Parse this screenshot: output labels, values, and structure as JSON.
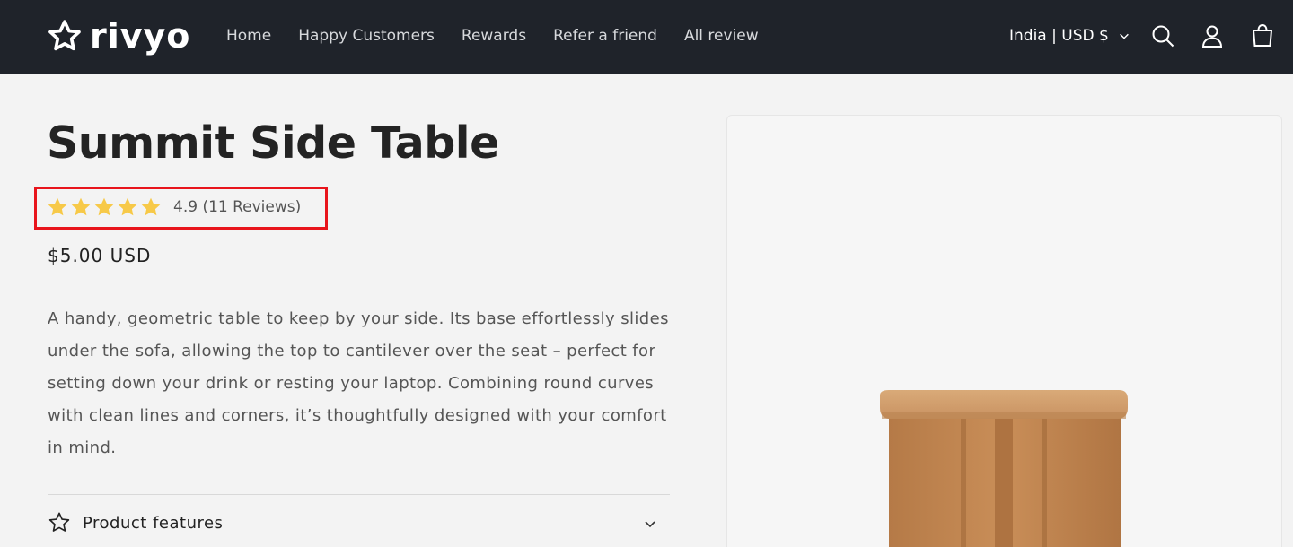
{
  "header": {
    "logo_text": "rivyo",
    "nav": [
      "Home",
      "Happy Customers",
      "Rewards",
      "Refer a friend",
      "All review"
    ],
    "currency": "India | USD $",
    "icons": [
      "search-icon",
      "account-icon",
      "cart-icon"
    ]
  },
  "product": {
    "title": "Summit Side Table",
    "rating": 4.9,
    "rating_max": 5,
    "rating_text": "4.9 (11 Reviews)",
    "price": "$5.00 USD",
    "description": "A handy, geometric table to keep by your side. Its base effortlessly slides under the sofa, allowing the top to cantilever over the seat – perfect for setting down your drink or resting your laptop. Combining round curves with clean lines and corners, it’s thoughtfully designed with your comfort in mind.",
    "features_label": "Product features"
  },
  "colors": {
    "header_bg": "#1f232a",
    "star": "#f7c948",
    "highlight_border": "#e8141b"
  }
}
